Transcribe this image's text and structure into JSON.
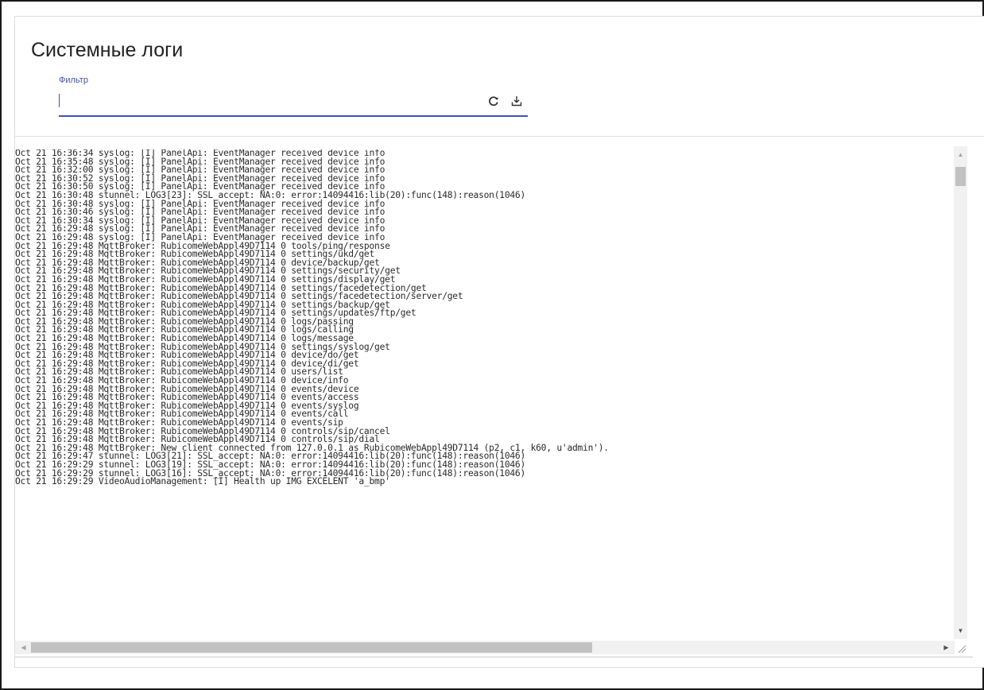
{
  "page": {
    "title": "Системные логи"
  },
  "filter": {
    "label": "Фильтр",
    "value": "",
    "placeholder": ""
  },
  "icons": {
    "refresh": "refresh-icon",
    "download": "download-icon"
  },
  "colors": {
    "accent": "#3f51b5",
    "text": "#2a2a2a"
  },
  "logs": [
    "Oct 21 16:36:34 syslog: [I] PanelApi: EventManager received device info",
    "Oct 21 16:35:48 syslog: [I] PanelApi: EventManager received device info",
    "Oct 21 16:32:00 syslog: [I] PanelApi: EventManager received device info",
    "Oct 21 16:30:52 syslog: [I] PanelApi: EventManager received device info",
    "Oct 21 16:30:50 syslog: [I] PanelApi: EventManager received device info",
    "Oct 21 16:30:48 stunnel: LOG3[23]: SSL_accept: NA:0: error:14094416:lib(20):func(148):reason(1046)",
    "Oct 21 16:30:48 syslog: [I] PanelApi: EventManager received device info",
    "Oct 21 16:30:46 syslog: [I] PanelApi: EventManager received device info",
    "Oct 21 16:30:34 syslog: [I] PanelApi: EventManager received device info",
    "Oct 21 16:29:48 syslog: [I] PanelApi: EventManager received device info",
    "Oct 21 16:29:48 syslog: [I] PanelApi: EventManager received device info",
    "Oct 21 16:29:48 MqttBroker: RubicomeWebAppl49D7114 0 tools/ping/response",
    "Oct 21 16:29:48 MqttBroker: RubicomeWebAppl49D7114 0 settings/ukd/get",
    "Oct 21 16:29:48 MqttBroker: RubicomeWebAppl49D7114 0 device/backup/get",
    "Oct 21 16:29:48 MqttBroker: RubicomeWebAppl49D7114 0 settings/security/get",
    "Oct 21 16:29:48 MqttBroker: RubicomeWebAppl49D7114 0 settings/display/get",
    "Oct 21 16:29:48 MqttBroker: RubicomeWebAppl49D7114 0 settings/facedetection/get",
    "Oct 21 16:29:48 MqttBroker: RubicomeWebAppl49D7114 0 settings/facedetection/server/get",
    "Oct 21 16:29:48 MqttBroker: RubicomeWebAppl49D7114 0 settings/backup/get",
    "Oct 21 16:29:48 MqttBroker: RubicomeWebAppl49D7114 0 settings/updates/ftp/get",
    "Oct 21 16:29:48 MqttBroker: RubicomeWebAppl49D7114 0 logs/passing",
    "Oct 21 16:29:48 MqttBroker: RubicomeWebAppl49D7114 0 logs/calling",
    "Oct 21 16:29:48 MqttBroker: RubicomeWebAppl49D7114 0 logs/message",
    "Oct 21 16:29:48 MqttBroker: RubicomeWebAppl49D7114 0 settings/syslog/get",
    "Oct 21 16:29:48 MqttBroker: RubicomeWebAppl49D7114 0 device/do/get",
    "Oct 21 16:29:48 MqttBroker: RubicomeWebAppl49D7114 0 device/di/get",
    "Oct 21 16:29:48 MqttBroker: RubicomeWebAppl49D7114 0 users/list",
    "Oct 21 16:29:48 MqttBroker: RubicomeWebAppl49D7114 0 device/info",
    "Oct 21 16:29:48 MqttBroker: RubicomeWebAppl49D7114 0 events/device",
    "Oct 21 16:29:48 MqttBroker: RubicomeWebAppl49D7114 0 events/access",
    "Oct 21 16:29:48 MqttBroker: RubicomeWebAppl49D7114 0 events/syslog",
    "Oct 21 16:29:48 MqttBroker: RubicomeWebAppl49D7114 0 events/call",
    "Oct 21 16:29:48 MqttBroker: RubicomeWebAppl49D7114 0 events/sip",
    "Oct 21 16:29:48 MqttBroker: RubicomeWebAppl49D7114 0 controls/sip/cancel",
    "Oct 21 16:29:48 MqttBroker: RubicomeWebAppl49D7114 0 controls/sip/dial",
    "Oct 21 16:29:48 MqttBroker: New client connected from 127.0.0.1 as RubicomeWebAppl49D7114 (p2, c1, k60, u'admin').",
    "Oct 21 16:29:47 stunnel: LOG3[21]: SSL_accept: NA:0: error:14094416:lib(20):func(148):reason(1046)",
    "Oct 21 16:29:29 stunnel: LOG3[19]: SSL_accept: NA:0: error:14094416:lib(20):func(148):reason(1046)",
    "Oct 21 16:29:29 stunnel: LOG3[16]: SSL_accept: NA:0: error:14094416:lib(20):func(148):reason(1046)",
    "Oct 21 16:29:29 VideoAudioManagement: [I] Health up IMG EXCELENT 'a_bmp'"
  ]
}
